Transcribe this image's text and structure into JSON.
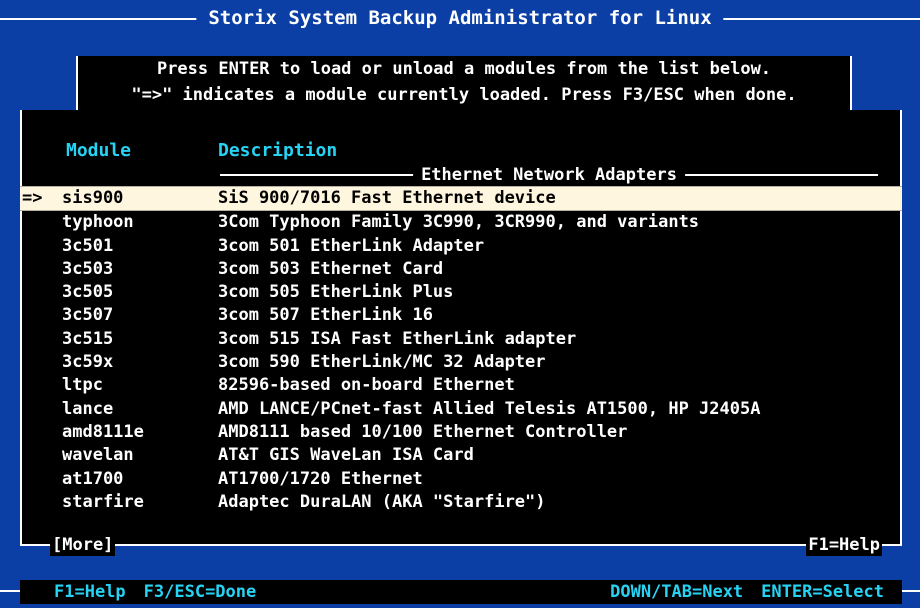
{
  "window": {
    "title": "Storix System Backup Administrator for Linux"
  },
  "instructions": {
    "line1": "Press ENTER to load or unload a modules from the list below.",
    "line2": "\"=>\" indicates a module currently loaded. Press F3/ESC when done."
  },
  "table": {
    "headers": {
      "module": "Module",
      "description": "Description"
    },
    "group_label": "Ethernet Network Adapters",
    "rows": [
      {
        "marker": "=>",
        "module": "sis900",
        "description": "SiS 900/7016 Fast Ethernet device",
        "selected": true
      },
      {
        "marker": "",
        "module": "typhoon",
        "description": "3Com Typhoon Family 3C990, 3CR990, and variants"
      },
      {
        "marker": "",
        "module": "3c501",
        "description": "3com 501 EtherLink Adapter"
      },
      {
        "marker": "",
        "module": "3c503",
        "description": "3com 503 Ethernet Card"
      },
      {
        "marker": "",
        "module": "3c505",
        "description": "3com 505 EtherLink Plus"
      },
      {
        "marker": "",
        "module": "3c507",
        "description": "3com 507 EtherLink 16"
      },
      {
        "marker": "",
        "module": "3c515",
        "description": "3com 515 ISA Fast EtherLink adapter"
      },
      {
        "marker": "",
        "module": "3c59x",
        "description": "3com 590 EtherLink/MC 32 Adapter"
      },
      {
        "marker": "",
        "module": "ltpc",
        "description": "82596-based on-board Ethernet"
      },
      {
        "marker": "",
        "module": "lance",
        "description": "AMD LANCE/PCnet-fast Allied Telesis AT1500, HP J2405A"
      },
      {
        "marker": "",
        "module": "amd8111e",
        "description": "AMD8111 based 10/100 Ethernet Controller"
      },
      {
        "marker": "",
        "module": "wavelan",
        "description": "AT&T GIS WaveLan ISA Card"
      },
      {
        "marker": "",
        "module": "at1700",
        "description": "AT1700/1720 Ethernet"
      },
      {
        "marker": "",
        "module": "starfire",
        "description": "Adaptec DuraLAN (AKA \"Starfire\")"
      }
    ],
    "more_label": "[More]",
    "help_label": "F1=Help"
  },
  "footer": {
    "help": "F1=Help",
    "done": "F3/ESC=Done",
    "next": "DOWN/TAB=Next",
    "select": "ENTER=Select"
  },
  "colors": {
    "background": "#0b3fa6",
    "panel": "#000000",
    "header_text": "#27d3f3",
    "selected_row": "#fff6df"
  }
}
